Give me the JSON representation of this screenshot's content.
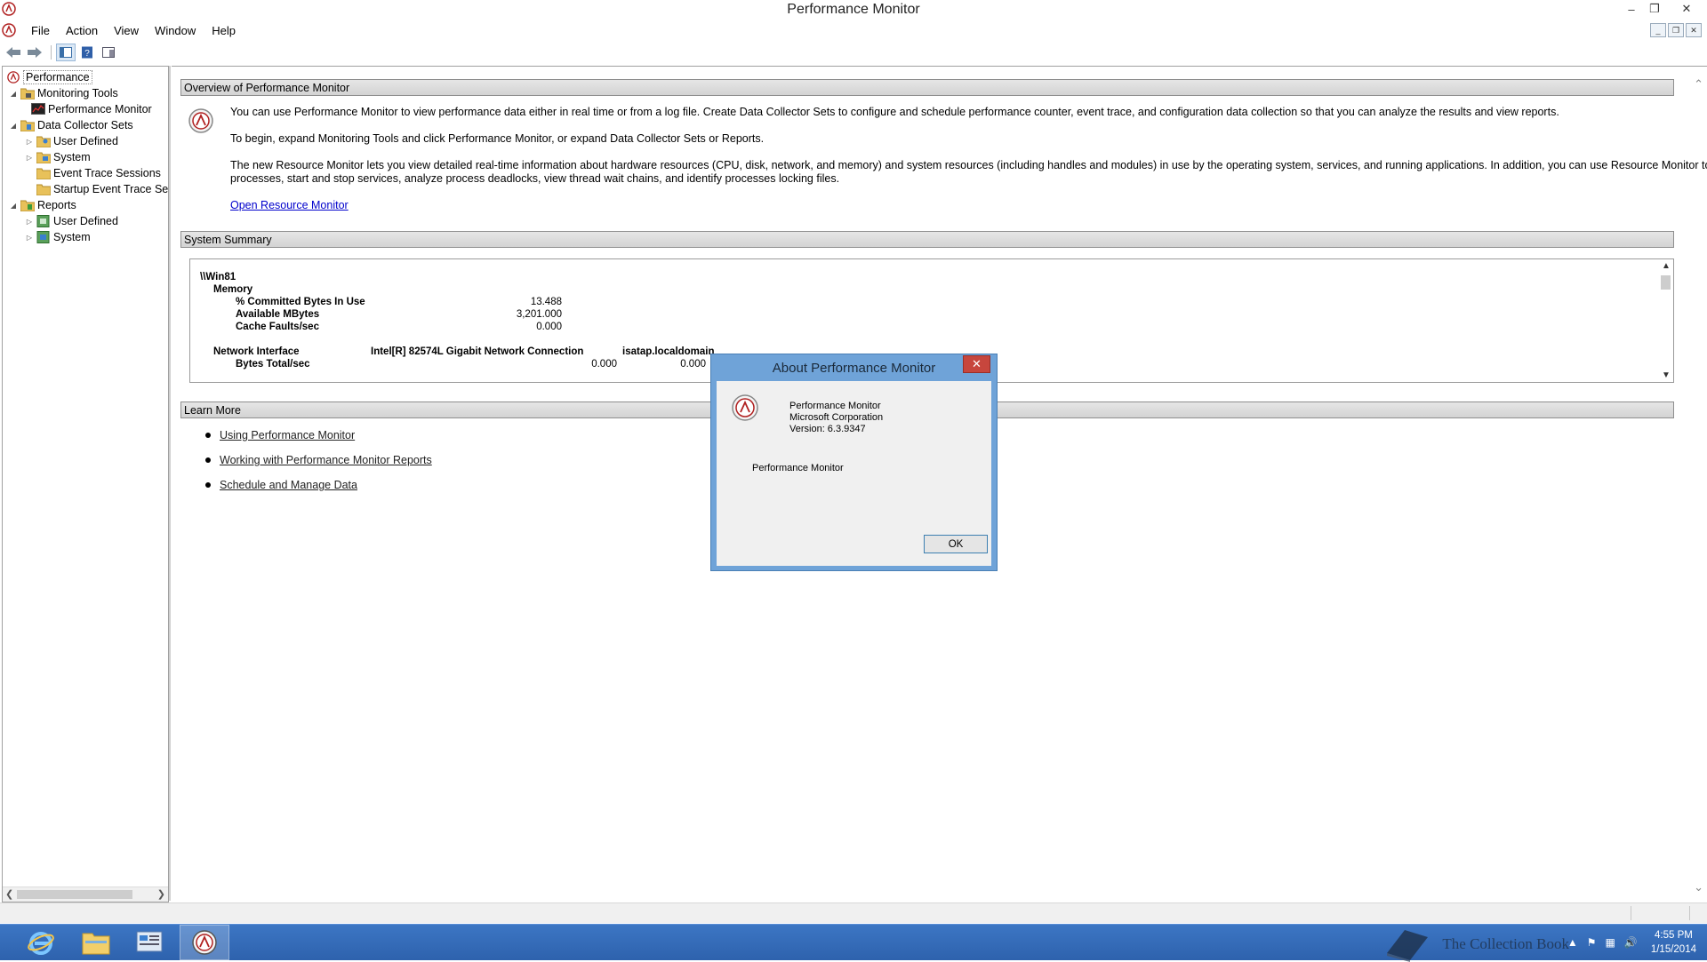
{
  "window": {
    "title": "Performance Monitor"
  },
  "menu": [
    "File",
    "Action",
    "View",
    "Window",
    "Help"
  ],
  "tree": {
    "root": "Performance",
    "monitoring_tools": "Monitoring Tools",
    "performance_monitor": "Performance Monitor",
    "data_collector_sets": "Data Collector Sets",
    "dcs_user_defined": "User Defined",
    "dcs_system": "System",
    "event_trace_sessions": "Event Trace Sessions",
    "startup_event_trace": "Startup Event Trace Ses",
    "reports": "Reports",
    "reports_user_defined": "User Defined",
    "reports_system": "System"
  },
  "overview": {
    "header": "Overview of Performance Monitor",
    "p1": "You can use Performance Monitor to view performance data either in real time or from a log file. Create Data Collector Sets to configure and schedule performance counter, event trace, and configuration data collection so that you can analyze the results and view reports.",
    "p2": "To begin, expand Monitoring Tools and click Performance Monitor, or expand Data Collector Sets or Reports.",
    "p3a": "The new Resource Monitor lets you view detailed real-time information about hardware resources (CPU, disk, network, and memory) and system resources (including handles and modules) in use by the operating system, services, and running applications. In addition, you can use Resource Monitor to stop",
    "p3b": "processes, start and stop services, analyze process deadlocks, view thread wait chains, and identify processes locking files.",
    "link": "Open Resource Monitor"
  },
  "summary": {
    "header": "System Summary",
    "machine": "\\\\Win81",
    "memory_label": "Memory",
    "counters": [
      {
        "name": "% Committed Bytes In Use",
        "value": "13.488"
      },
      {
        "name": "Available MBytes",
        "value": "3,201.000"
      },
      {
        "name": "Cache Faults/sec",
        "value": "0.000"
      }
    ],
    "network_label": "Network Interface",
    "network_adapter": "Intel[R] 82574L Gigabit Network Connection",
    "network_adapter2": "isatap.localdomain",
    "bytes_total_label": "Bytes Total/sec",
    "bytes_total_value": "0.000",
    "bytes_total_value2": "0.000"
  },
  "learn_more": {
    "header": "Learn More",
    "links": [
      "Using Performance Monitor",
      "Working with Performance Monitor Reports",
      "Schedule and Manage Data"
    ]
  },
  "dialog": {
    "title": "About Performance Monitor",
    "close": "✕",
    "product": "Performance Monitor",
    "company": "Microsoft Corporation",
    "version": "Version: 6.3.9347",
    "description": "Performance Monitor",
    "ok": "OK"
  },
  "taskbar": {
    "watermark": "The Collection Book",
    "time": "4:55 PM",
    "date": "1/15/2014"
  }
}
